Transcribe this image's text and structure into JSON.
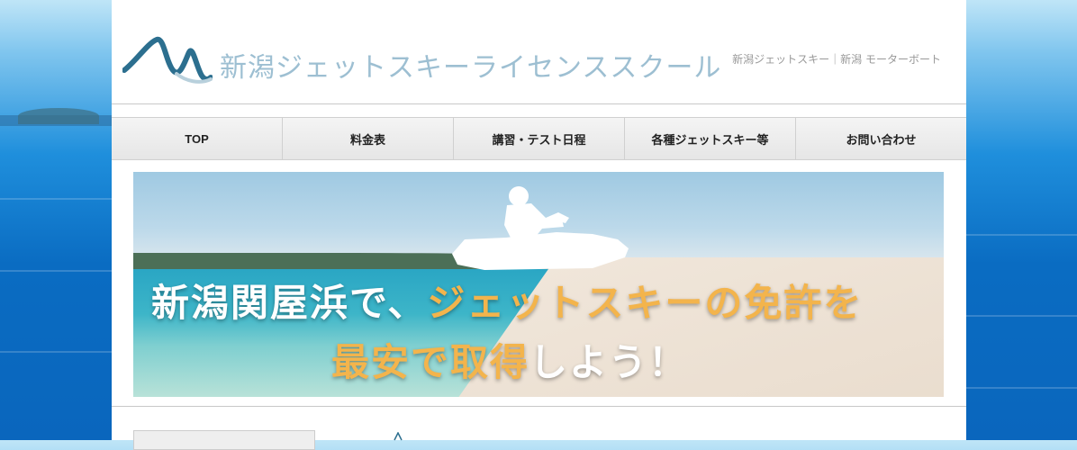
{
  "header": {
    "site_title": "新潟ジェットスキーライセンススクール",
    "tagline": "新潟ジェットスキー｜新潟 モーターボート"
  },
  "nav": {
    "items": [
      {
        "label": "TOP"
      },
      {
        "label": "料金表"
      },
      {
        "label": "講習・テスト日程"
      },
      {
        "label": "各種ジェットスキー等"
      },
      {
        "label": "お問い合わせ"
      }
    ]
  },
  "hero": {
    "line1_a": "新潟関屋浜で、",
    "line1_b": "ジェットスキーの免許を",
    "line2_a": "最安で取得",
    "line2_b": "しよう！"
  },
  "colors": {
    "accent": "#f3b44c",
    "title": "#9dbfd2"
  },
  "icons": {
    "logo": "wave-logo-icon",
    "jetski": "jetski-rider-icon"
  }
}
